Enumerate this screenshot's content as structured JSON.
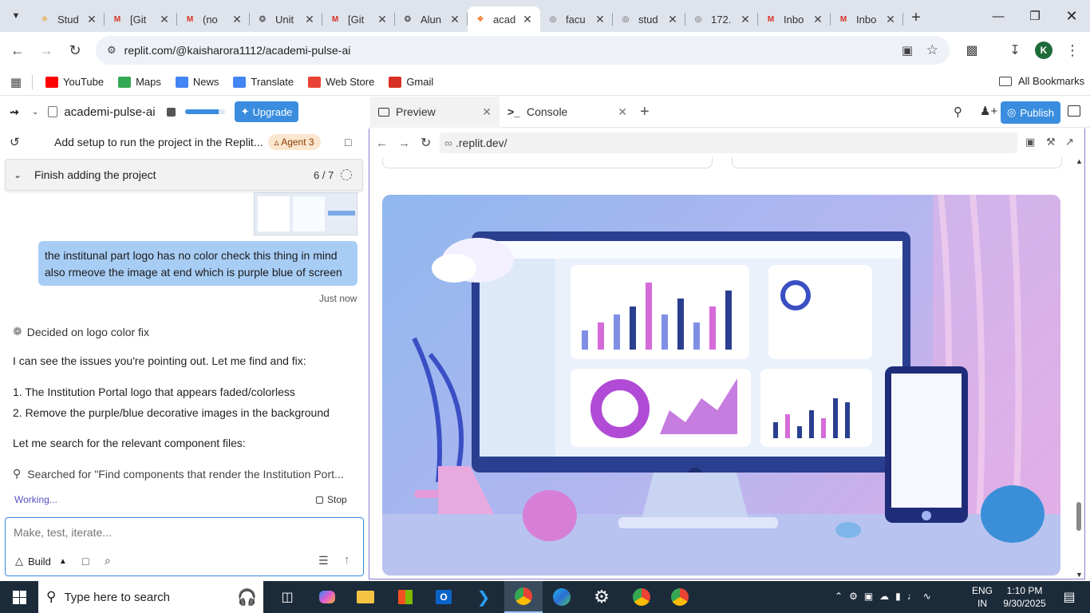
{
  "browser": {
    "tabs": [
      {
        "title": "Stud",
        "icon": "pinwheel-icon",
        "color": "#e8a33d"
      },
      {
        "title": "[Git",
        "icon": "gmail-icon",
        "color": "#d93025"
      },
      {
        "title": "(no",
        "icon": "gmail-icon",
        "color": "#d93025"
      },
      {
        "title": "Unit",
        "icon": "openai-icon",
        "color": "#333333"
      },
      {
        "title": "[Git",
        "icon": "gmail-icon",
        "color": "#d93025"
      },
      {
        "title": "Alun",
        "icon": "openai-icon",
        "color": "#333333"
      },
      {
        "title": "acad",
        "icon": "replit-icon",
        "color": "#f26207",
        "active": true
      },
      {
        "title": "facu",
        "icon": "globe-icon",
        "color": "#555555"
      },
      {
        "title": "stud",
        "icon": "globe-icon",
        "color": "#555555"
      },
      {
        "title": "172.",
        "icon": "globe-icon",
        "color": "#555555"
      },
      {
        "title": "Inbo",
        "icon": "gmail-icon",
        "color": "#d93025"
      },
      {
        "title": "Inbo",
        "icon": "gmail-icon",
        "color": "#d93025"
      }
    ],
    "url": "replit.com/@kaisharora1112/academi-pulse-ai",
    "profile_initial": "K",
    "bookmarks": [
      {
        "label": "YouTube",
        "icon": "youtube-icon",
        "color": "#ff0000"
      },
      {
        "label": "Maps",
        "icon": "maps-icon",
        "color": "#34a853"
      },
      {
        "label": "News",
        "icon": "news-icon",
        "color": "#4285f4"
      },
      {
        "label": "Translate",
        "icon": "translate-icon",
        "color": "#4285f4"
      },
      {
        "label": "Web Store",
        "icon": "webstore-icon",
        "color": "#ea4335"
      },
      {
        "label": "Gmail",
        "icon": "gmail-icon",
        "color": "#d93025"
      }
    ],
    "all_bookmarks": "All Bookmarks"
  },
  "replit": {
    "project_name": "academi-pulse-ai",
    "upgrade_label": "Upgrade",
    "thread_title": "Add setup to run the project in the Replit...",
    "agent_badge": "Agent 3",
    "task_title": "Finish adding the project",
    "task_progress": "6 / 7",
    "user_message": "the institunal part logo has no color check this thing in mind also rmeove the image at end which is purple blue of screen",
    "user_message_time": "Just now",
    "decided": "Decided on logo color fix",
    "agent_intro": "I can see the issues you're pointing out. Let me find and fix:",
    "agent_points": [
      "1. The Institution Portal logo that appears faded/colorless",
      "2. Remove the purple/blue decorative images in the background"
    ],
    "agent_search": "Let me search for the relevant component files:",
    "searched_for": "Searched for \"Find components that render the Institution Port...",
    "working": "Working...",
    "stop": "Stop",
    "composer_placeholder": "Make, test, iterate...",
    "build_label": "Build",
    "preview_tab": "Preview",
    "console_tab": "Console",
    "publish_label": "Publish",
    "preview_url": ".replit.dev/",
    "accent": "#3a8dde"
  },
  "taskbar": {
    "search_placeholder": "Type here to search",
    "lang1": "ENG",
    "lang2": "IN",
    "time": "1:10 PM",
    "date": "9/30/2025"
  }
}
